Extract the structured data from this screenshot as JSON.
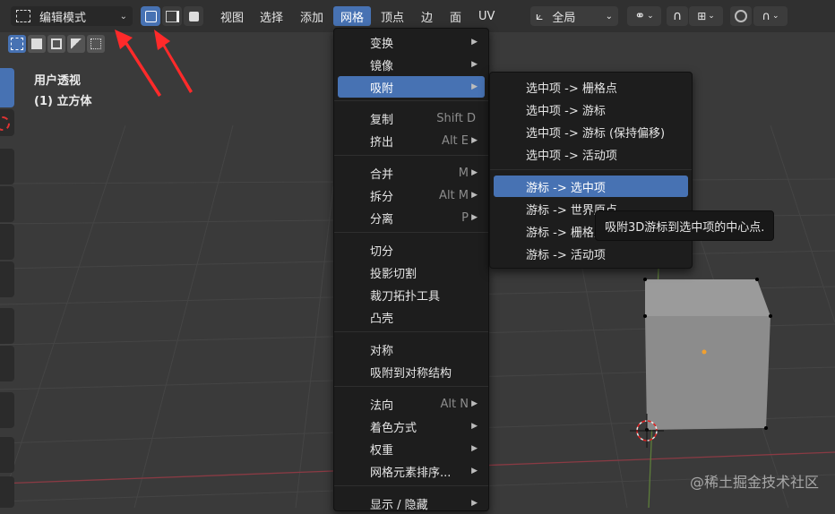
{
  "header": {
    "mode_dropdown": {
      "label": "编辑模式",
      "icon": "edit-mode-icon"
    },
    "select_modes": [
      "vertex-select-icon",
      "edge-select-icon",
      "face-select-icon"
    ],
    "menus": [
      "视图",
      "选择",
      "添加",
      "网格",
      "顶点",
      "边",
      "面",
      "UV"
    ],
    "active_menu": "网格",
    "transform_orientation": {
      "label": "全局"
    },
    "snapping": {
      "icon": "magnet-icon"
    },
    "proportional_editing": {
      "icon": "falloff-icon"
    }
  },
  "viewport_info": {
    "view_name": "用户透视",
    "object_name": "(1) 立方体"
  },
  "selection_tools": [
    "select-new-icon",
    "select-extend-icon",
    "select-subtract-icon",
    "select-invert-icon",
    "select-intersect-icon"
  ],
  "mesh_menu": {
    "items": [
      {
        "label": "变换",
        "shortcut": "",
        "submenu": true
      },
      {
        "label": "镜像",
        "shortcut": "",
        "submenu": true
      },
      {
        "label": "吸附",
        "shortcut": "",
        "submenu": true,
        "highlighted": true
      },
      {
        "label": "复制",
        "shortcut": "Shift D",
        "submenu": false
      },
      {
        "label": "挤出",
        "shortcut": "Alt E",
        "submenu": true
      },
      {
        "label": "合并",
        "shortcut": "M",
        "submenu": true
      },
      {
        "label": "拆分",
        "shortcut": "Alt M",
        "submenu": true
      },
      {
        "label": "分离",
        "shortcut": "P",
        "submenu": true
      },
      {
        "label": "切分",
        "shortcut": "",
        "submenu": false
      },
      {
        "label": "投影切割",
        "shortcut": "",
        "submenu": false
      },
      {
        "label": "裁刀拓扑工具",
        "shortcut": "",
        "submenu": false
      },
      {
        "label": "凸壳",
        "shortcut": "",
        "submenu": false
      },
      {
        "label": "对称",
        "shortcut": "",
        "submenu": false
      },
      {
        "label": "吸附到对称结构",
        "shortcut": "",
        "submenu": false
      },
      {
        "label": "法向",
        "shortcut": "Alt N",
        "submenu": true
      },
      {
        "label": "着色方式",
        "shortcut": "",
        "submenu": true
      },
      {
        "label": "权重",
        "shortcut": "",
        "submenu": true
      },
      {
        "label": "网格元素排序...",
        "shortcut": "",
        "submenu": true
      },
      {
        "label": "显示 / 隐藏",
        "shortcut": "",
        "submenu": true
      }
    ]
  },
  "snap_submenu": {
    "items": [
      {
        "label": "选中项 -> 栅格点"
      },
      {
        "label": "选中项 -> 游标"
      },
      {
        "label": "选中项 -> 游标 (保持偏移)"
      },
      {
        "label": "选中项 -> 活动项"
      },
      {
        "label": "游标 -> 选中项",
        "highlighted": true
      },
      {
        "label": "游标 -> 世界原点"
      },
      {
        "label": "游标 -> 栅格点"
      },
      {
        "label": "游标 -> 活动项"
      }
    ]
  },
  "tooltip": {
    "text": "吸附3D游标到选中项的中心点."
  },
  "watermark": {
    "text": "@稀土掘金技术社区"
  },
  "colors": {
    "accent": "#4772b3",
    "menu_bg": "#1d1d1d",
    "header_bg": "#303030",
    "viewport_bg": "#3a3a3a",
    "annotation_arrow": "#ff2a2a"
  }
}
